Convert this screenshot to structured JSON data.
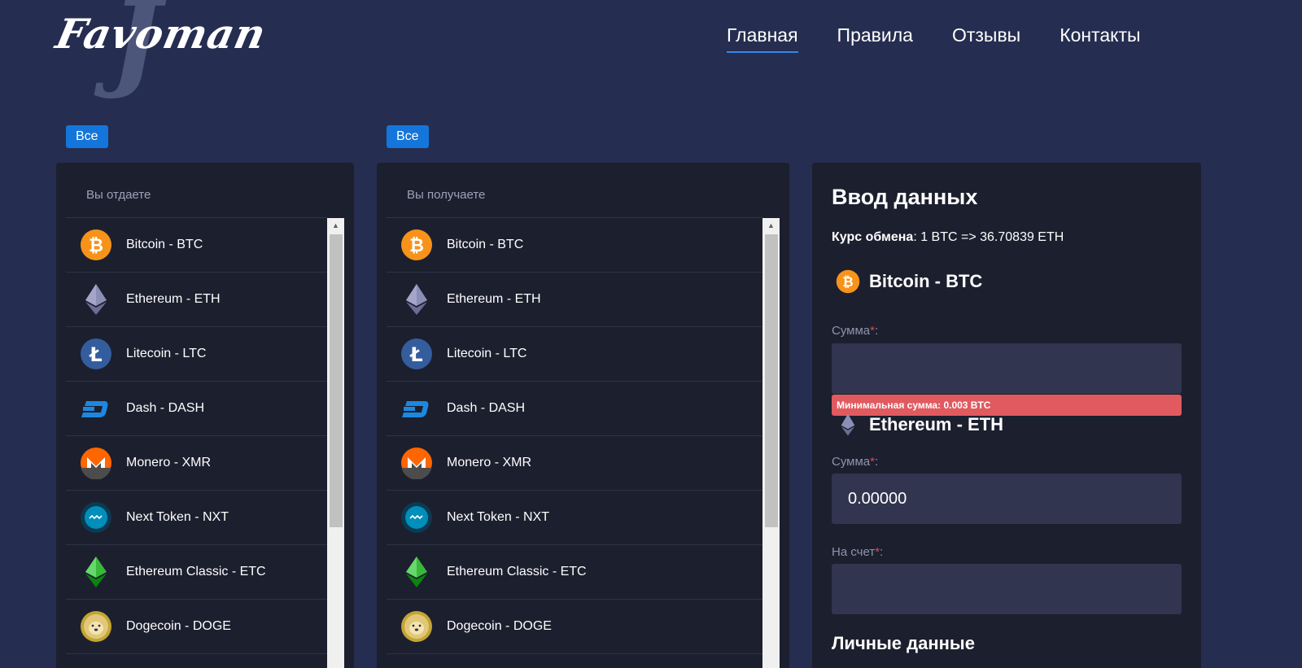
{
  "header": {
    "logo_text": "Favoman",
    "nav": [
      {
        "label": "Главная",
        "active": true
      },
      {
        "label": "Правила",
        "active": false
      },
      {
        "label": "Отзывы",
        "active": false
      },
      {
        "label": "Контакты",
        "active": false
      }
    ]
  },
  "give_panel": {
    "filter_label": "Все",
    "title": "Вы отдаете"
  },
  "receive_panel": {
    "filter_label": "Все",
    "title": "Вы получаете"
  },
  "coins": [
    {
      "label": "Bitcoin - BTC",
      "icon": "bitcoin-icon"
    },
    {
      "label": "Ethereum - ETH",
      "icon": "ethereum-icon"
    },
    {
      "label": "Litecoin - LTC",
      "icon": "litecoin-icon"
    },
    {
      "label": "Dash - DASH",
      "icon": "dash-icon"
    },
    {
      "label": "Monero - XMR",
      "icon": "monero-icon"
    },
    {
      "label": "Next Token - NXT",
      "icon": "nxt-icon"
    },
    {
      "label": "Ethereum Classic - ETC",
      "icon": "ethereum-classic-icon"
    },
    {
      "label": "Dogecoin - DOGE",
      "icon": "dogecoin-icon"
    }
  ],
  "form": {
    "title": "Ввод данных",
    "rate_label": "Курс обмена",
    "rate_value": ": 1 BTC => 36.70839 ETH",
    "give_coin": "Bitcoin - BTC",
    "give_amount_label": "Сумма",
    "give_amount_value": "",
    "error_text": "Минимальная сумма: 0.003 BTC",
    "receive_coin": "Ethereum - ETH",
    "receive_amount_label": "Сумма",
    "receive_amount_value": "0.00000",
    "account_label": "На счет",
    "account_value": "",
    "required_mark": "*",
    "label_suffix": ":",
    "personal_section": "Личные данные"
  },
  "colors": {
    "background": "#252d50",
    "panel": "#1c1f2e",
    "accent": "#1476db",
    "error": "#e05a5f",
    "input": "#313550"
  }
}
